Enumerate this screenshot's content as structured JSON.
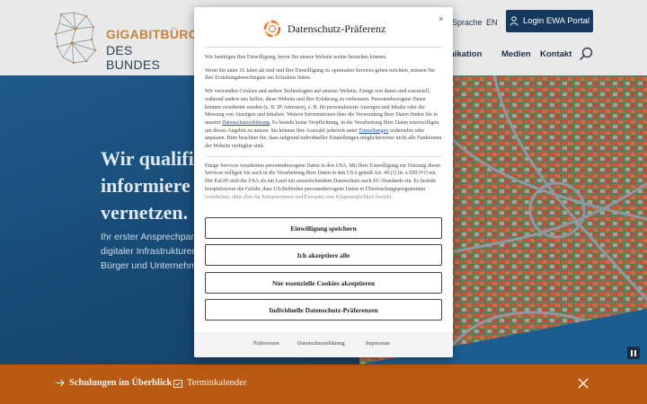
{
  "header": {
    "logo_line1": "GIGABITBÜRO",
    "logo_line2": "DES BUNDES",
    "lang_sprache": "Sprache",
    "lang_en": "EN",
    "ewa_button": "Login EWA Portal",
    "nav": [
      "nikation",
      "Medien",
      "Kontakt"
    ]
  },
  "hero": {
    "title_lines": [
      "Wir qualifi",
      "informiere",
      "vernetzen."
    ],
    "text_lines": [
      "Ihr erster Ansprechpart",
      "digitaler Infrastrukturen",
      "Bürger und Unternehm"
    ]
  },
  "bottom_bar": {
    "link1": "Schulungen im Überblick",
    "link2": "Terminkalender"
  },
  "modal": {
    "title": "Datenschutz-Präferenz",
    "close": "×",
    "paragraphs": [
      "Wir benötigen Ihre Einwilligung, bevor Sie unsere Website weiter besuchen können.",
      "Wenn Sie unter 16 Jahre alt sind und Ihre Einwilligung zu optionalen Services geben möchten, müssen Sie Ihre Erziehungsberechtigten um Erlaubnis bitten.",
      "Wir verwenden Cookies und andere Technologien auf unserer Website. Einige von ihnen sind essenziell, während andere uns helfen, diese Website und Ihre Erfahrung zu verbessern. Personenbezogene Daten können verarbeitet werden (z. B. IP-Adressen), z. B. für personalisierte Anzeigen und Inhalte oder die Messung von Anzeigen und Inhalten. Weitere Informationen über die Verwendung Ihrer Daten finden Sie in unserer",
      ". Es besteht keine Verpflichtung, in die Verarbeitung Ihrer Daten einzuwilligen, um dieses Angebot zu nutzen. Sie können Ihre Auswahl jederzeit unter",
      "widerrufen oder anpassen. Bitte beachten Sie, dass aufgrund individueller Einstellungen möglicherweise nicht alle Funktionen der Website verfügbar sind.",
      "Einige Services verarbeiten personenbezogene Daten in den USA. Mit Ihrer Einwilligung zur Nutzung dieser Services willigen Sie auch in die Verarbeitung Ihrer Daten in den USA gemäß Art. 49 (1) lit. a DSGVO ein. Der EuGH stuft die USA als ein Land mit unzureichendem Datenschutz nach EU-Standards ein. Es besteht beispielsweise die Gefahr, dass US-Behörden personenbezogene Daten in Überwachungsprogrammen verarbeiten, ohne dass für Europäerinnen und Europäer eine Klagemöglichkeit besteht."
    ],
    "link_datenschutz": "Datenschutzerklärung",
    "link_einstellungen": "Einstellungen",
    "buttons": [
      "Einwilligung speichern",
      "Ich akzeptiere alle",
      "Nur essenzielle Cookies akzeptieren",
      "Individuelle Datenschutz-Präferenzen"
    ],
    "footer_links": [
      "Präferenzen",
      "Datenschutzerklärung",
      "Impressum"
    ]
  },
  "colors": {
    "brand_orange": "#b95a13",
    "navy": "#17385e",
    "logo_gold": "#c8843a"
  }
}
